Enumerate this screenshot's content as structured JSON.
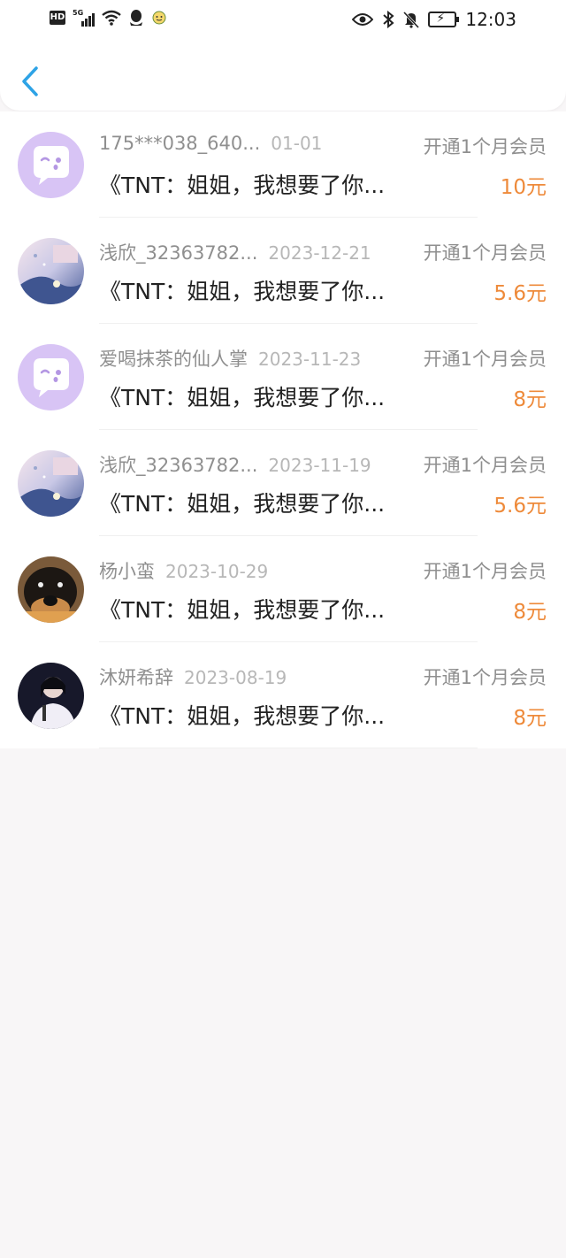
{
  "status_bar": {
    "hd": "HD",
    "network": "5G",
    "time": "12:03"
  },
  "header": {
    "back_icon": "chevron-left-icon",
    "accent": "#2ea3e6"
  },
  "list": [
    {
      "name": "175***038_640...",
      "date": "01-01",
      "meta": "开通1个月会员",
      "title": "《TNT：姐姐，我想要了你...",
      "price": "10元",
      "avatar": "bubble"
    },
    {
      "name": "浅欣_32363782...",
      "date": "2023-12-21",
      "meta": "开通1个月会员",
      "title": "《TNT：姐姐，我想要了你...",
      "price": "5.6元",
      "avatar": "pastel"
    },
    {
      "name": "爱喝抹茶的仙人掌",
      "date": "2023-11-23",
      "meta": "开通1个月会员",
      "title": "《TNT：姐姐，我想要了你...",
      "price": "8元",
      "avatar": "bubble"
    },
    {
      "name": "浅欣_32363782...",
      "date": "2023-11-19",
      "meta": "开通1个月会员",
      "title": "《TNT：姐姐，我想要了你...",
      "price": "5.6元",
      "avatar": "pastel"
    },
    {
      "name": "杨小蛮",
      "date": "2023-10-29",
      "meta": "开通1个月会员",
      "title": "《TNT：姐姐，我想要了你...",
      "price": "8元",
      "avatar": "dog"
    },
    {
      "name": "沐妍希辞",
      "date": "2023-08-19",
      "meta": "开通1个月会员",
      "title": "《TNT：姐姐，我想要了你...",
      "price": "8元",
      "avatar": "person"
    }
  ],
  "colors": {
    "price": "#ee8a3a",
    "secondary_text": "#8f8f8f",
    "background": "#f8f6f7"
  }
}
